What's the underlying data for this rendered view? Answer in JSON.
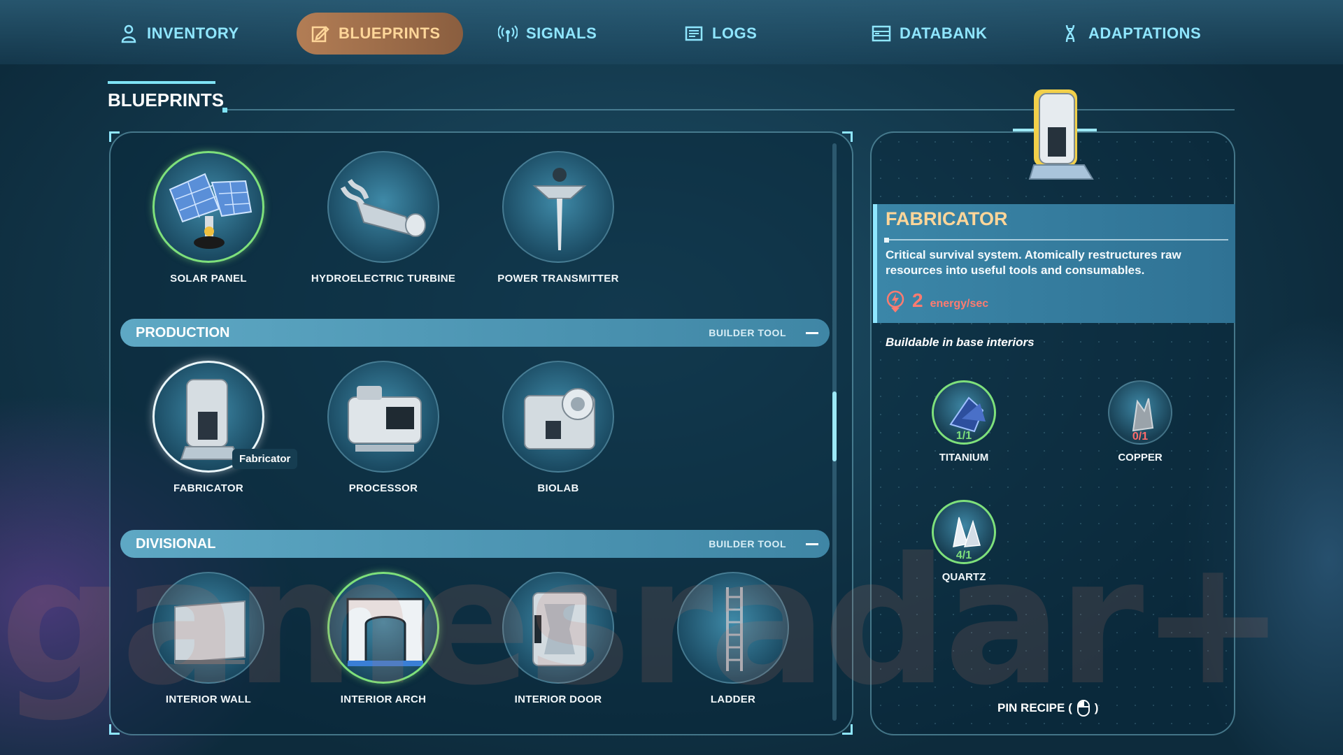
{
  "nav": {
    "tabs": [
      {
        "label": "INVENTORY",
        "icon": "person-icon"
      },
      {
        "label": "BLUEPRINTS",
        "icon": "blueprint-icon",
        "active": true
      },
      {
        "label": "SIGNALS",
        "icon": "signal-icon"
      },
      {
        "label": "LOGS",
        "icon": "log-icon"
      },
      {
        "label": "DATABANK",
        "icon": "databank-icon"
      },
      {
        "label": "ADAPTATIONS",
        "icon": "dna-icon"
      }
    ]
  },
  "section": {
    "title": "BLUEPRINTS"
  },
  "power_items": [
    {
      "label": "SOLAR PANEL",
      "available": true
    },
    {
      "label": "HYDROELECTRIC TURBINE",
      "available": false
    },
    {
      "label": "POWER TRANSMITTER",
      "available": false
    }
  ],
  "production": {
    "name": "PRODUCTION",
    "tool": "BUILDER TOOL",
    "items": [
      {
        "label": "FABRICATOR",
        "selected": true
      },
      {
        "label": "PROCESSOR"
      },
      {
        "label": "BIOLAB"
      }
    ],
    "tooltip": "Fabricator"
  },
  "divisional": {
    "name": "DIVISIONAL",
    "tool": "BUILDER TOOL",
    "items": [
      {
        "label": "INTERIOR WALL"
      },
      {
        "label": "INTERIOR ARCH",
        "available": true
      },
      {
        "label": "INTERIOR DOOR"
      },
      {
        "label": "LADDER"
      }
    ]
  },
  "detail": {
    "title": "FABRICATOR",
    "description": "Critical survival system. Atomically restructures raw resources into useful tools and consumables.",
    "energy_value": "2",
    "energy_unit": "energy/sec",
    "buildable": "Buildable in base interiors",
    "resources": [
      {
        "name": "TITANIUM",
        "count": "1/1",
        "status": "ok"
      },
      {
        "name": "COPPER",
        "count": "0/1",
        "status": "missing"
      },
      {
        "name": "QUARTZ",
        "count": "4/1",
        "status": "ok"
      }
    ],
    "pin_label_left": "PIN RECIPE (",
    "pin_label_right": ")"
  },
  "watermark": "gamesradar+",
  "colors": {
    "accent_cyan": "#8fe6ff",
    "active_tab": "#b27d55",
    "title_gold": "#ffd699",
    "ok_green": "#7ee07b",
    "missing_red": "#ff6b6b",
    "energy_red": "#ff7b70"
  }
}
